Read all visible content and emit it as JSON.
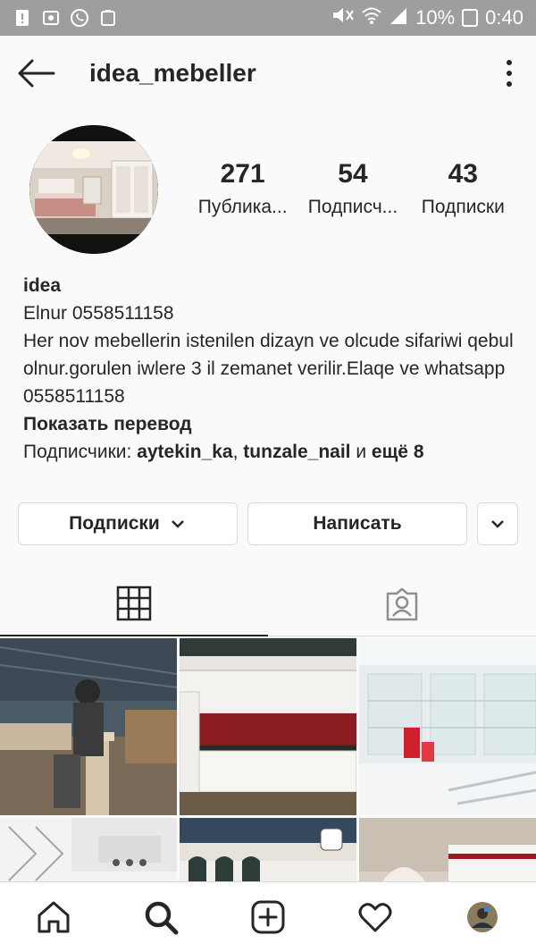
{
  "status_bar": {
    "battery": "10%",
    "time": "0:40"
  },
  "header": {
    "username": "idea_mebeller"
  },
  "stats": [
    {
      "value": "271",
      "label": "Публика..."
    },
    {
      "value": "54",
      "label": "Подписч..."
    },
    {
      "value": "43",
      "label": "Подписки"
    }
  ],
  "bio": {
    "name": "idea",
    "line1": "Elnur 0558511158",
    "text": "Her nov mebellerin istenilen dizayn ve olcude sifariwi qebul olnur.gorulen iwlere 3 il zemanet verilir.Elaqe ve whatsapp 0558511158",
    "translate": "Показать перевод",
    "followers_prefix": "Подписчики: ",
    "follower1": "aytekin_ka",
    "sep": ", ",
    "follower2": "tunzale_nail",
    "and": " и ",
    "more": "ещё 8"
  },
  "buttons": {
    "following": "Подписки",
    "message": "Написать"
  },
  "icons": {
    "back": "arrow-left-icon",
    "more": "vertical-dots-icon",
    "grid": "grid-icon",
    "tagged": "tagged-person-icon",
    "home": "home-icon",
    "search": "search-icon",
    "add": "add-post-icon",
    "activity": "heart-icon",
    "profile": "profile-avatar-icon"
  },
  "colors": {
    "status_bar": "#9e9e9e",
    "text": "#262626",
    "border": "#dbdbdb",
    "background": "#fafafa"
  }
}
